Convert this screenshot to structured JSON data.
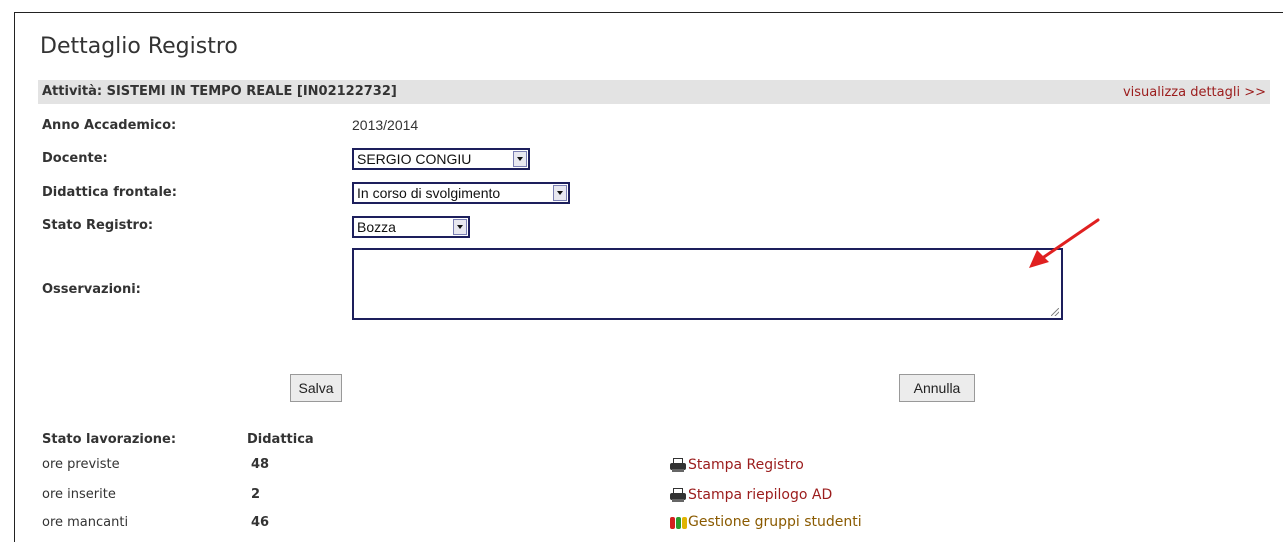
{
  "page": {
    "title": "Dettaglio Registro"
  },
  "activity": {
    "label": "Attività: SISTEMI IN TEMPO REALE [IN02122732]",
    "details_link": "visualizza dettagli >>"
  },
  "form": {
    "anno_label": "Anno Accademico:",
    "anno_value": "2013/2014",
    "docente_label": "Docente:",
    "docente_value": "SERGIO CONGIU",
    "didattica_label": "Didattica frontale:",
    "didattica_value": "In corso di svolgimento",
    "stato_label": "Stato Registro:",
    "stato_value": "Bozza",
    "osservazioni_label": "Osservazioni:",
    "osservazioni_value": ""
  },
  "buttons": {
    "save": "Salva",
    "cancel": "Annulla"
  },
  "summary": {
    "header_left": "Stato lavorazione:",
    "header_right": "Didattica",
    "rows": [
      {
        "label": "ore previste",
        "value": "48"
      },
      {
        "label": "ore inserite",
        "value": "2"
      },
      {
        "label": "ore mancanti",
        "value": "46"
      }
    ]
  },
  "links": [
    {
      "label": "Stampa Registro",
      "icon": "printer-icon"
    },
    {
      "label": "Stampa riepilogo AD",
      "icon": "printer-icon"
    },
    {
      "label": "Gestione gruppi studenti",
      "icon": "group-icon"
    }
  ],
  "colors": {
    "link": "#9b1c1c",
    "bar": "#e3e3e3",
    "annotation_arrow": "#e02020"
  }
}
